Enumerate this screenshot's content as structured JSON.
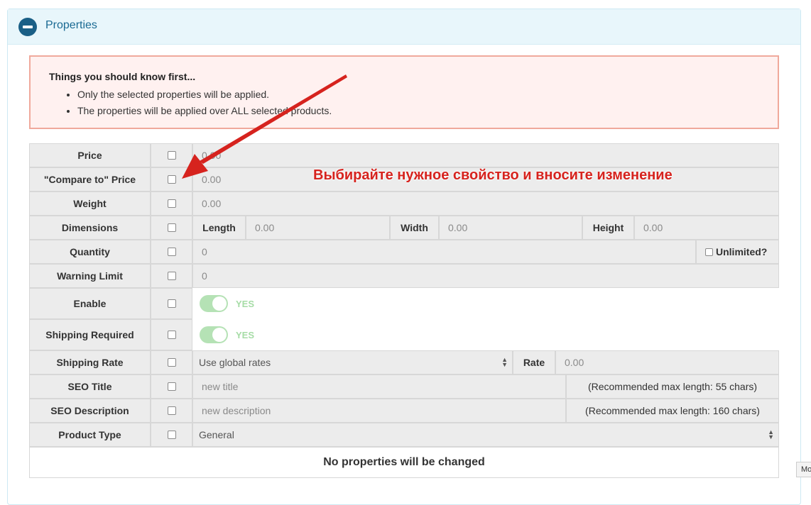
{
  "panel": {
    "title": "Properties"
  },
  "notice": {
    "title": "Things you should know first...",
    "items": [
      "Only the selected properties will be applied.",
      "The properties will be applied over ALL selected products."
    ]
  },
  "rows": {
    "price": {
      "label": "Price",
      "placeholder": "0.00"
    },
    "compare_price": {
      "label": "\"Compare to\" Price",
      "placeholder": "0.00"
    },
    "weight": {
      "label": "Weight",
      "placeholder": "0.00"
    },
    "dimensions": {
      "label": "Dimensions",
      "length_label": "Length",
      "length_placeholder": "0.00",
      "width_label": "Width",
      "width_placeholder": "0.00",
      "height_label": "Height",
      "height_placeholder": "0.00"
    },
    "quantity": {
      "label": "Quantity",
      "placeholder": "0",
      "unlimited_label": "Unlimited?"
    },
    "warning_limit": {
      "label": "Warning Limit",
      "placeholder": "0"
    },
    "enable": {
      "label": "Enable",
      "toggle_text": "YES"
    },
    "shipping_required": {
      "label": "Shipping Required",
      "toggle_text": "YES"
    },
    "shipping_rate": {
      "label": "Shipping Rate",
      "selected": "Use global rates",
      "rate_label": "Rate",
      "rate_placeholder": "0.00"
    },
    "seo_title": {
      "label": "SEO Title",
      "placeholder": "new title",
      "hint": "(Recommended max length: 55 chars)"
    },
    "seo_description": {
      "label": "SEO Description",
      "placeholder": "new description",
      "hint": "(Recommended max length: 160 chars)"
    },
    "product_type": {
      "label": "Product Type",
      "selected": "General"
    }
  },
  "summary": "No properties will be changed",
  "annotation": {
    "text": "Выбирайте нужное свойство и вносите изменение",
    "color": "#d6231e"
  },
  "corner_tab": "Mo",
  "colors": {
    "accent": "#1a5f86",
    "notice_border": "#f0a99c",
    "toggle_on": "#b5e2b5"
  }
}
